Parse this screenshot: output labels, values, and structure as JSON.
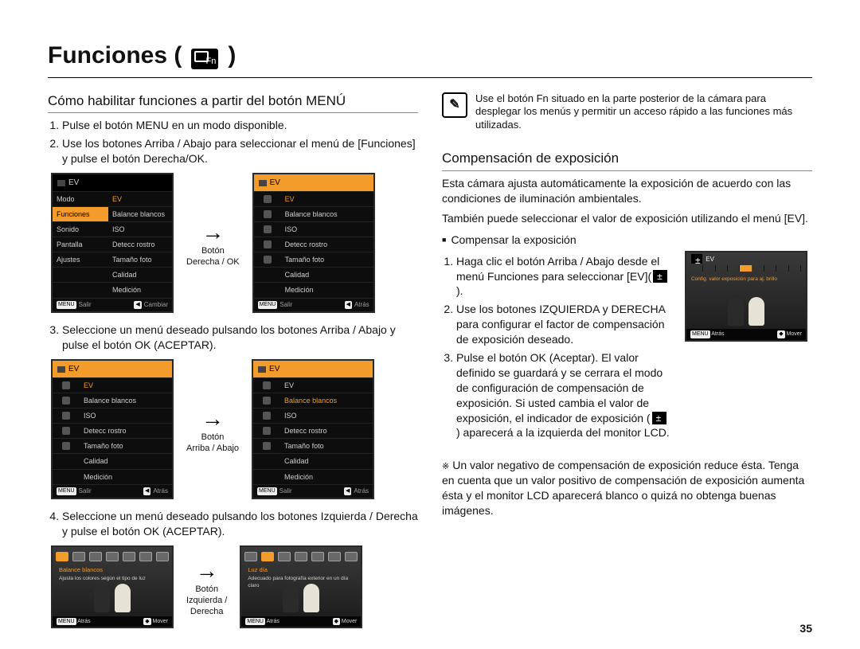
{
  "page_number": "35",
  "title": "Funciones (",
  "title_suffix": " )",
  "left": {
    "heading": "Cómo habilitar funciones a partir del botón MENÚ",
    "step1": "Pulse el botón MENU en un modo disponible.",
    "step2": "Use los botones Arriba / Abajo para seleccionar el menú de [Funciones] y pulse el botón Derecha/OK.",
    "step3": "Seleccione un menú deseado pulsando los botones Arriba / Abajo y pulse el botón OK (ACEPTAR).",
    "step4": "Seleccione un menú deseado pulsando los botones Izquierda / Derecha y pulse el botón OK (ACEPTAR).",
    "fig1": {
      "caption": "Botón\nDerecha / OK",
      "left_menu": {
        "header": "EV",
        "items_left": [
          "Modo",
          "Funciones",
          "Sonido",
          "Pantalla",
          "Ajustes"
        ],
        "items_right": [
          "EV",
          "Balance blancos",
          "ISO",
          "Detecc rostro",
          "Tamaño foto",
          "Calidad",
          "Medición"
        ],
        "foot_left": "Salir",
        "foot_right": "Cambiar"
      },
      "right_menu": {
        "header": "EV",
        "items_right": [
          "EV",
          "Balance blancos",
          "ISO",
          "Detecc rostro",
          "Tamaño foto",
          "Calidad",
          "Medición"
        ],
        "foot_left": "Salir",
        "foot_right": "Atrás"
      }
    },
    "fig2": {
      "caption": "Botón\nArriba / Abajo",
      "left_menu": {
        "header": "EV",
        "items_right": [
          "EV",
          "Balance blancos",
          "ISO",
          "Detecc rostro",
          "Tamaño foto",
          "Calidad",
          "Medición"
        ],
        "foot_left": "Salir",
        "foot_right": "Atrás"
      },
      "right_menu": {
        "header": "EV",
        "items_right": [
          "EV",
          "Balance blancos",
          "ISO",
          "Detecc rostro",
          "Tamaño foto",
          "Calidad",
          "Medición"
        ],
        "foot_left": "Salir",
        "foot_right": "Atrás"
      }
    },
    "fig3": {
      "caption": "Botón\nIzquierda /\nDerecha",
      "left_mock": {
        "title": "Balance blancos",
        "sub": "Ajusta los colores según el tipo de luz",
        "foot_left": "Atrás",
        "foot_right": "Mover"
      },
      "right_mock": {
        "title": "Luz día",
        "sub": "Adecuado para fotografía exterior en un día claro",
        "foot_left": "Atrás",
        "foot_right": "Mover"
      }
    }
  },
  "right": {
    "note": "Use el botón Fn situado en la parte posterior de la cámara para desplegar los menús y permitir un acceso rápido a las funciones más utilizadas.",
    "heading": "Compensación de exposición",
    "intro1": "Esta cámara ajusta automáticamente la exposición de acuerdo con las condiciones de iluminación ambientales.",
    "intro2": "También puede seleccionar el valor de exposición utilizando el menú [EV].",
    "subhead": "Compensar la exposición",
    "step1": "Haga clic el botón Arriba / Abajo desde el menú Funciones para seleccionar [EV](",
    "step1_suffix": " ).",
    "step2": "Use los botones IZQUIERDA y DERECHA para configurar el factor de compensación de exposición deseado.",
    "step3": "Pulse el botón OK (Aceptar). El valor definido se guardará y se cerrara el modo de configuración de compensación de exposición. Si usted cambia el valor de exposición, el indicador de exposición (",
    "step3_suffix2": " )   aparecerá a la izquierda del monitor LCD.",
    "ev_mock": {
      "ev_label": "EV",
      "caption": "Config. valor exposición para aj. brillo",
      "foot_left": "Atrás",
      "foot_right": "Mover"
    },
    "footnote": "Un valor negativo de compensación de exposición reduce ésta. Tenga en cuenta que un valor positivo de compensación de exposición aumenta ésta y el monitor LCD aparecerá blanco o quizá no obtenga buenas imágenes."
  }
}
